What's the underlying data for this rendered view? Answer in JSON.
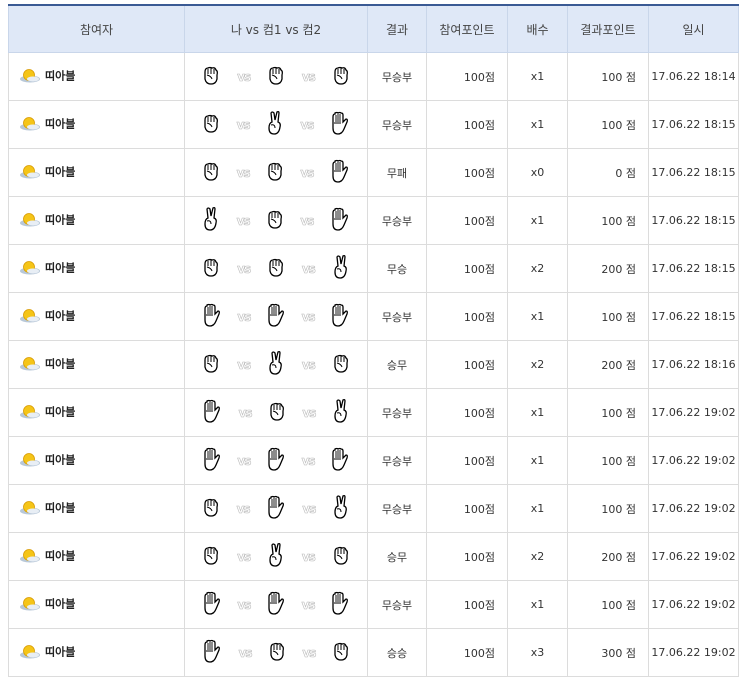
{
  "headers": [
    "참여자",
    "나 vs 컴1 vs 컴2",
    "결과",
    "참여포인트",
    "배수",
    "결과포인트",
    "일시"
  ],
  "vs_label": "vs",
  "rows": [
    {
      "name": "띠아블",
      "hands": [
        "rock",
        "rock",
        "rock"
      ],
      "result": "무승부",
      "bet": "100점",
      "mult": "x1",
      "points": "100 점",
      "date": "17.06.22 18:14"
    },
    {
      "name": "띠아블",
      "hands": [
        "rock",
        "scissors",
        "paper"
      ],
      "result": "무승부",
      "bet": "100점",
      "mult": "x1",
      "points": "100 점",
      "date": "17.06.22 18:15"
    },
    {
      "name": "띠아블",
      "hands": [
        "rock",
        "rock",
        "paper"
      ],
      "result": "무패",
      "bet": "100점",
      "mult": "x0",
      "points": "0 점",
      "date": "17.06.22 18:15"
    },
    {
      "name": "띠아블",
      "hands": [
        "scissors",
        "rock",
        "paper"
      ],
      "result": "무승부",
      "bet": "100점",
      "mult": "x1",
      "points": "100 점",
      "date": "17.06.22 18:15"
    },
    {
      "name": "띠아블",
      "hands": [
        "rock",
        "rock",
        "scissors"
      ],
      "result": "무승",
      "bet": "100점",
      "mult": "x2",
      "points": "200 점",
      "date": "17.06.22 18:15"
    },
    {
      "name": "띠아블",
      "hands": [
        "paper",
        "paper",
        "paper"
      ],
      "result": "무승부",
      "bet": "100점",
      "mult": "x1",
      "points": "100 점",
      "date": "17.06.22 18:15"
    },
    {
      "name": "띠아블",
      "hands": [
        "rock",
        "scissors",
        "rock"
      ],
      "result": "승무",
      "bet": "100점",
      "mult": "x2",
      "points": "200 점",
      "date": "17.06.22 18:16"
    },
    {
      "name": "띠아블",
      "hands": [
        "paper",
        "rock",
        "scissors"
      ],
      "result": "무승부",
      "bet": "100점",
      "mult": "x1",
      "points": "100 점",
      "date": "17.06.22 19:02"
    },
    {
      "name": "띠아블",
      "hands": [
        "paper",
        "paper",
        "paper"
      ],
      "result": "무승부",
      "bet": "100점",
      "mult": "x1",
      "points": "100 점",
      "date": "17.06.22 19:02"
    },
    {
      "name": "띠아블",
      "hands": [
        "rock",
        "paper",
        "scissors"
      ],
      "result": "무승부",
      "bet": "100점",
      "mult": "x1",
      "points": "100 점",
      "date": "17.06.22 19:02"
    },
    {
      "name": "띠아블",
      "hands": [
        "rock",
        "scissors",
        "rock"
      ],
      "result": "승무",
      "bet": "100점",
      "mult": "x2",
      "points": "200 점",
      "date": "17.06.22 19:02"
    },
    {
      "name": "띠아블",
      "hands": [
        "paper",
        "paper",
        "paper"
      ],
      "result": "무승부",
      "bet": "100점",
      "mult": "x1",
      "points": "100 점",
      "date": "17.06.22 19:02"
    },
    {
      "name": "띠아블",
      "hands": [
        "paper",
        "rock",
        "rock"
      ],
      "result": "승승",
      "bet": "100점",
      "mult": "x3",
      "points": "300 점",
      "date": "17.06.22 19:02"
    }
  ]
}
